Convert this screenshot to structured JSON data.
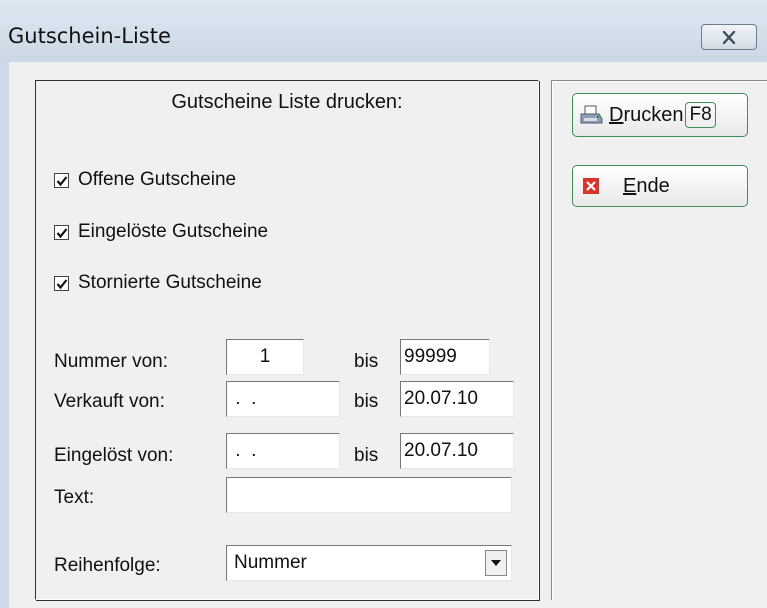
{
  "window": {
    "title": "Gutschein-Liste"
  },
  "form": {
    "heading": "Gutscheine Liste drucken:",
    "checkboxes": [
      {
        "label": "Offene Gutscheine",
        "checked": true
      },
      {
        "label": "Eingelöste Gutscheine",
        "checked": true
      },
      {
        "label": "Stornierte Gutscheine",
        "checked": true
      }
    ],
    "nummer": {
      "label": "Nummer von:",
      "from": "1",
      "bis_label": "bis",
      "to": "99999"
    },
    "verkauft": {
      "label": "Verkauft von:",
      "from": " .  .",
      "bis_label": "bis",
      "to": "20.07.10"
    },
    "eingeloest": {
      "label": "Eingelöst von:",
      "from": " .  .",
      "bis_label": "bis",
      "to": "20.07.10"
    },
    "text": {
      "label": "Text:",
      "value": ""
    },
    "reihenfolge": {
      "label": "Reihenfolge:",
      "value": "Nummer"
    }
  },
  "buttons": {
    "drucken": {
      "mnemonic": "D",
      "rest": "rucken",
      "shortcut": "F8",
      "icon": "printer-icon"
    },
    "ende": {
      "mnemonic": "E",
      "rest": "nde",
      "icon": "red-x-icon"
    }
  },
  "colors": {
    "title_bg": "#d4e0ec",
    "client_bg": "#f0f0f0",
    "button_border": "#3e8f5a",
    "ende_icon": "#d9342b"
  }
}
